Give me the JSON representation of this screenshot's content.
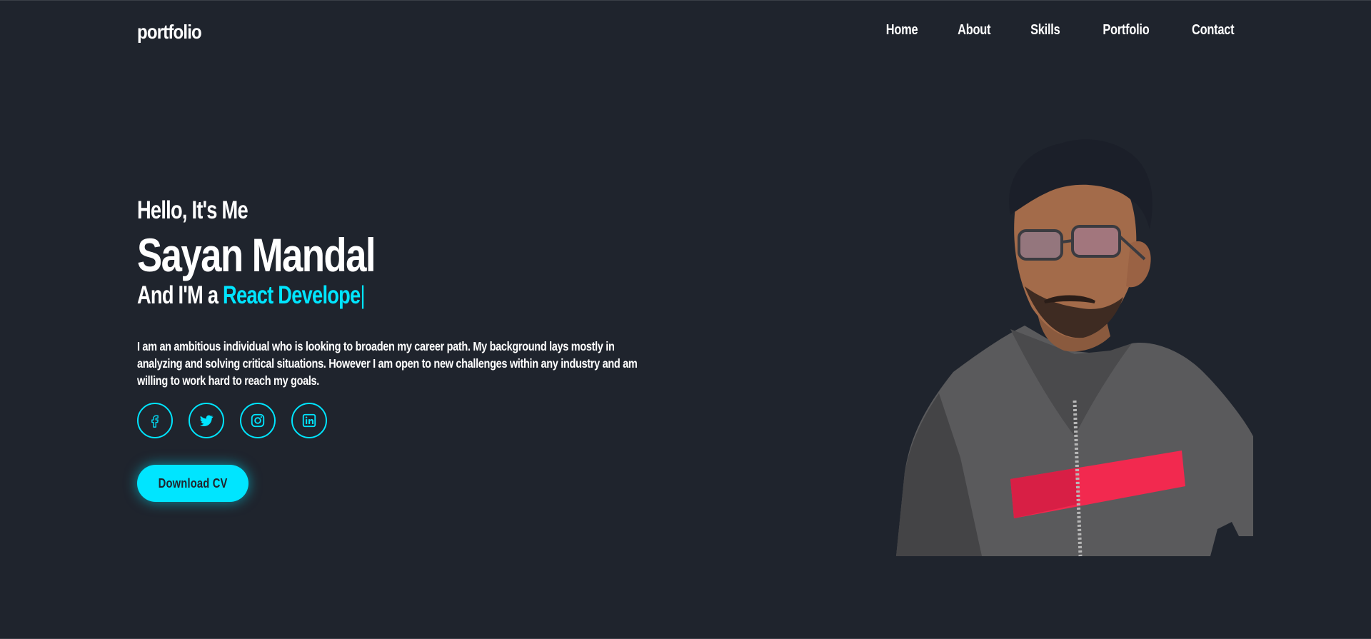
{
  "header": {
    "logo": "portfolio",
    "nav": [
      "Home",
      "About",
      "Skills",
      "Portfolio",
      "Contact"
    ]
  },
  "hero": {
    "greeting": "Hello, It's Me",
    "name": "Sayan Mandal",
    "role_prefix": "And I'M a",
    "role_highlight": "React Develope",
    "role_cursor": "|",
    "description": "I am an ambitious individual who is looking to broaden my career path. My background lays mostly in analyzing and solving critical situations. However I am open to new challenges within any industry and am willing to work hard to reach my goals.",
    "download_button": "Download CV"
  },
  "socials": [
    {
      "icon": "facebook-icon"
    },
    {
      "icon": "twitter-icon"
    },
    {
      "icon": "instagram-icon"
    },
    {
      "icon": "linkedin-icon"
    }
  ],
  "colors": {
    "background": "#1f242d",
    "accent": "#00e5ff",
    "text": "#ffffff"
  }
}
